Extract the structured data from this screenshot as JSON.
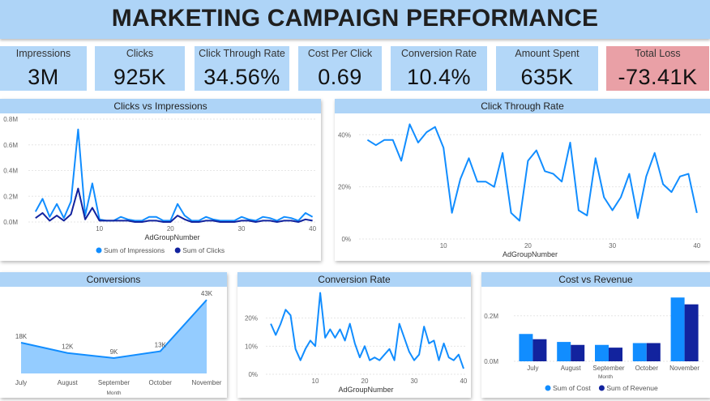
{
  "dashboard_title": "MARKETING CAMPAIGN PERFORMANCE",
  "colors": {
    "light_blue": "#118dff",
    "dark_blue": "#12239e",
    "header": "#aed4f7",
    "loss": "#e9a0a6"
  },
  "kpis": [
    {
      "label": "Impressions",
      "value": "3M"
    },
    {
      "label": "Clicks",
      "value": "925K"
    },
    {
      "label": "Click Through Rate",
      "value": "34.56%"
    },
    {
      "label": "Cost Per Click",
      "value": "0.69"
    },
    {
      "label": "Conversion Rate",
      "value": "10.4%"
    },
    {
      "label": "Amount Spent",
      "value": "635K"
    },
    {
      "label": "Total Loss",
      "value": "-73.41K"
    }
  ],
  "chart_data": [
    {
      "type": "line",
      "title": "Clicks vs Impressions",
      "xlabel": "AdGroupNumber",
      "ylabel": "",
      "x": [
        1,
        2,
        3,
        4,
        5,
        6,
        7,
        8,
        9,
        10,
        11,
        12,
        13,
        14,
        15,
        16,
        17,
        18,
        19,
        20,
        21,
        22,
        23,
        24,
        25,
        26,
        27,
        28,
        29,
        30,
        31,
        32,
        33,
        34,
        35,
        36,
        37,
        38,
        39,
        40
      ],
      "xticks": [
        "10",
        "20",
        "30",
        "40"
      ],
      "xtick_values": [
        10,
        20,
        30,
        40
      ],
      "yticks": [
        "0.0M",
        "0.2M",
        "0.4M",
        "0.6M",
        "0.8M"
      ],
      "ytick_values": [
        0,
        0.2,
        0.4,
        0.6,
        0.8
      ],
      "ylim": [
        0,
        0.8
      ],
      "xlim": [
        0,
        40.5
      ],
      "series": [
        {
          "name": "Sum of Impressions",
          "color": "#118dff",
          "values": [
            0.08,
            0.18,
            0.04,
            0.14,
            0.03,
            0.16,
            0.72,
            0.05,
            0.3,
            0.02,
            0.01,
            0.01,
            0.04,
            0.02,
            0.01,
            0.01,
            0.04,
            0.04,
            0.01,
            0.01,
            0.14,
            0.05,
            0.01,
            0.01,
            0.04,
            0.02,
            0.01,
            0.01,
            0.01,
            0.04,
            0.02,
            0.01,
            0.04,
            0.03,
            0.01,
            0.04,
            0.03,
            0.01,
            0.07,
            0.04
          ]
        },
        {
          "name": "Sum of Clicks",
          "color": "#12239e",
          "values": [
            0.03,
            0.07,
            0.01,
            0.05,
            0.01,
            0.06,
            0.26,
            0.02,
            0.11,
            0.01,
            0.01,
            0.01,
            0.01,
            0.01,
            0.0,
            0.0,
            0.01,
            0.01,
            0.0,
            0.0,
            0.05,
            0.02,
            0.0,
            0.0,
            0.01,
            0.01,
            0.0,
            0.0,
            0.0,
            0.01,
            0.01,
            0.0,
            0.01,
            0.01,
            0.0,
            0.01,
            0.01,
            0.0,
            0.02,
            0.01
          ]
        }
      ],
      "legend": "bottom"
    },
    {
      "type": "line",
      "title": "Click Through Rate",
      "xlabel": "AdGroupNumber",
      "ylabel": "",
      "x": [
        1,
        2,
        3,
        4,
        5,
        6,
        7,
        8,
        9,
        10,
        11,
        12,
        13,
        14,
        15,
        16,
        17,
        18,
        19,
        20,
        21,
        22,
        23,
        24,
        25,
        26,
        27,
        28,
        29,
        30,
        31,
        32,
        33,
        34,
        35,
        36,
        37,
        38,
        39,
        40
      ],
      "xticks": [
        "10",
        "20",
        "30",
        "40"
      ],
      "xtick_values": [
        10,
        20,
        30,
        40
      ],
      "yticks": [
        "0%",
        "20%",
        "40%"
      ],
      "ytick_values": [
        0,
        20,
        40
      ],
      "ylim": [
        0,
        46
      ],
      "xlim": [
        0,
        40.5
      ],
      "series": [
        {
          "name": "Click Through Rate",
          "color": "#118dff",
          "values": [
            38,
            36,
            38,
            38,
            30,
            44,
            37,
            41,
            43,
            35,
            10,
            23,
            31,
            22,
            22,
            20,
            33,
            10,
            7,
            30,
            34,
            26,
            25,
            22,
            37,
            11,
            9,
            31,
            16,
            11,
            16,
            25,
            8,
            24,
            33,
            21,
            18,
            24,
            25,
            10
          ]
        }
      ]
    },
    {
      "type": "area",
      "title": "Conversions",
      "xlabel": "Month",
      "categories": [
        "July",
        "August",
        "September",
        "October",
        "November"
      ],
      "values": [
        18,
        12,
        9,
        13,
        43
      ],
      "data_labels": [
        "18K",
        "12K",
        "9K",
        "13K",
        "43K"
      ],
      "color": "#118dff"
    },
    {
      "type": "line",
      "title": "Conversion Rate",
      "xlabel": "AdGroupNumber",
      "x": [
        1,
        2,
        3,
        4,
        5,
        6,
        7,
        8,
        9,
        10,
        11,
        12,
        13,
        14,
        15,
        16,
        17,
        18,
        19,
        20,
        21,
        22,
        23,
        24,
        25,
        26,
        27,
        28,
        29,
        30,
        31,
        32,
        33,
        34,
        35,
        36,
        37,
        38,
        39,
        40
      ],
      "xticks": [
        "10",
        "20",
        "30",
        "40"
      ],
      "xtick_values": [
        10,
        20,
        30,
        40
      ],
      "yticks": [
        "0%",
        "10%",
        "20%"
      ],
      "ytick_values": [
        0,
        10,
        20
      ],
      "ylim": [
        0,
        30
      ],
      "xlim": [
        0,
        40.5
      ],
      "series": [
        {
          "name": "Conversion Rate",
          "color": "#118dff",
          "values": [
            18,
            14,
            18,
            23,
            21,
            9,
            5,
            9,
            12,
            10,
            29,
            13,
            16,
            13,
            16,
            12,
            18,
            11,
            6,
            10,
            5,
            6,
            5,
            7,
            9,
            5,
            18,
            13,
            8,
            5,
            7,
            17,
            11,
            12,
            5,
            11,
            6,
            5,
            7,
            2
          ]
        }
      ]
    },
    {
      "type": "bar",
      "title": "Cost vs Revenue",
      "xlabel": "Month",
      "categories": [
        "July",
        "August",
        "September",
        "October",
        "November"
      ],
      "yticks": [
        "0.0M",
        "0.2M"
      ],
      "ytick_values": [
        0,
        0.2
      ],
      "ylim": [
        0,
        0.32
      ],
      "series": [
        {
          "name": "Sum of Cost",
          "color": "#118dff",
          "values": [
            0.12,
            0.085,
            0.072,
            0.08,
            0.28
          ]
        },
        {
          "name": "Sum of Revenue",
          "color": "#12239e",
          "values": [
            0.097,
            0.072,
            0.06,
            0.08,
            0.25
          ]
        }
      ],
      "legend": "bottom"
    }
  ]
}
